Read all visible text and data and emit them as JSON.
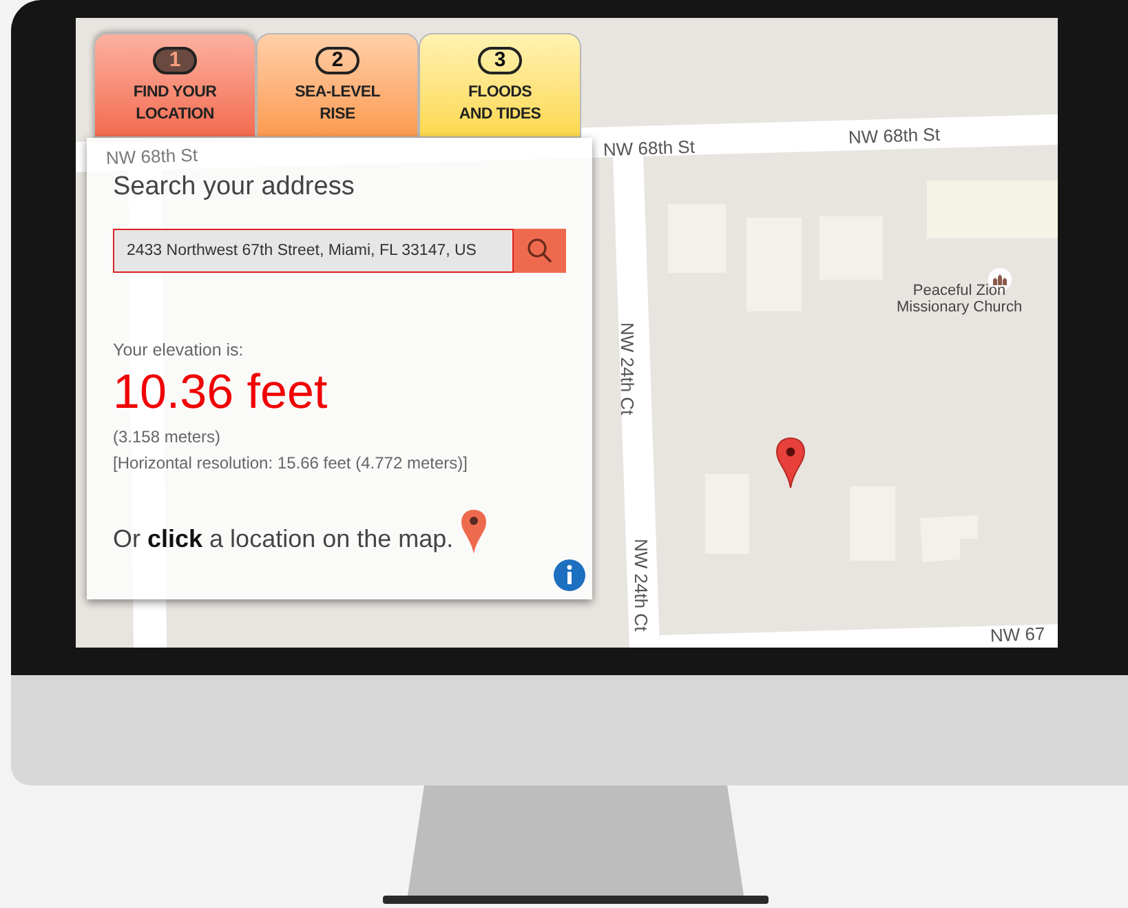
{
  "tabs": [
    {
      "number": "1",
      "label_lines": [
        "FIND YOUR",
        "LOCATION"
      ],
      "selected": true
    },
    {
      "number": "2",
      "label_lines": [
        "SEA-LEVEL",
        "RISE"
      ],
      "selected": false
    },
    {
      "number": "3",
      "label_lines": [
        "FLOODS",
        "AND TIDES"
      ],
      "selected": false
    }
  ],
  "search": {
    "heading": "Search your address",
    "value": "2433 Northwest 67th Street, Miami, FL 33147, US"
  },
  "result": {
    "label": "Your elevation is:",
    "elevation": "10.36 feet",
    "meters": "(3.158 meters)",
    "resolution": "[Horizontal resolution: 15.66 feet (4.772 meters)]"
  },
  "hint": "Or **click** a location on the map.",
  "map": {
    "street_labels": [
      {
        "text": "NW 68th St",
        "kind": "horizontal"
      },
      {
        "text": "NW 68th St",
        "kind": "horizontal"
      },
      {
        "text": "NW 68th St",
        "kind": "horizontal"
      },
      {
        "text": "NW 24th Ct",
        "kind": "vertical"
      },
      {
        "text": "NW 24th Ct",
        "kind": "vertical"
      },
      {
        "text": "NW 67",
        "kind": "horizontal"
      }
    ],
    "place": {
      "name_lines": [
        "Peaceful Zion",
        "Missionary Church"
      ]
    }
  }
}
